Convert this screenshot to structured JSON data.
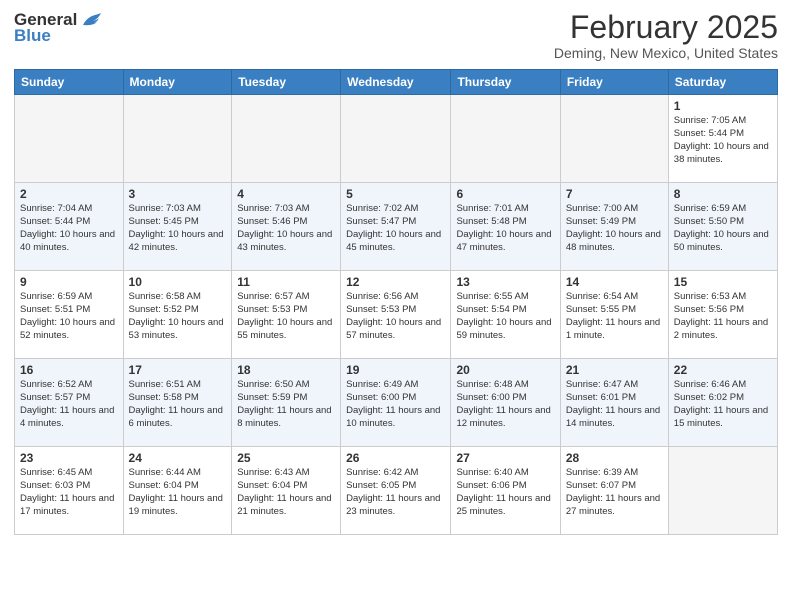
{
  "header": {
    "logo_general": "General",
    "logo_blue": "Blue",
    "month_title": "February 2025",
    "location": "Deming, New Mexico, United States"
  },
  "weekdays": [
    "Sunday",
    "Monday",
    "Tuesday",
    "Wednesday",
    "Thursday",
    "Friday",
    "Saturday"
  ],
  "weeks": [
    [
      {
        "day": "",
        "info": ""
      },
      {
        "day": "",
        "info": ""
      },
      {
        "day": "",
        "info": ""
      },
      {
        "day": "",
        "info": ""
      },
      {
        "day": "",
        "info": ""
      },
      {
        "day": "",
        "info": ""
      },
      {
        "day": "1",
        "info": "Sunrise: 7:05 AM\nSunset: 5:44 PM\nDaylight: 10 hours\nand 38 minutes."
      }
    ],
    [
      {
        "day": "2",
        "info": "Sunrise: 7:04 AM\nSunset: 5:44 PM\nDaylight: 10 hours\nand 40 minutes."
      },
      {
        "day": "3",
        "info": "Sunrise: 7:03 AM\nSunset: 5:45 PM\nDaylight: 10 hours\nand 42 minutes."
      },
      {
        "day": "4",
        "info": "Sunrise: 7:03 AM\nSunset: 5:46 PM\nDaylight: 10 hours\nand 43 minutes."
      },
      {
        "day": "5",
        "info": "Sunrise: 7:02 AM\nSunset: 5:47 PM\nDaylight: 10 hours\nand 45 minutes."
      },
      {
        "day": "6",
        "info": "Sunrise: 7:01 AM\nSunset: 5:48 PM\nDaylight: 10 hours\nand 47 minutes."
      },
      {
        "day": "7",
        "info": "Sunrise: 7:00 AM\nSunset: 5:49 PM\nDaylight: 10 hours\nand 48 minutes."
      },
      {
        "day": "8",
        "info": "Sunrise: 6:59 AM\nSunset: 5:50 PM\nDaylight: 10 hours\nand 50 minutes."
      }
    ],
    [
      {
        "day": "9",
        "info": "Sunrise: 6:59 AM\nSunset: 5:51 PM\nDaylight: 10 hours\nand 52 minutes."
      },
      {
        "day": "10",
        "info": "Sunrise: 6:58 AM\nSunset: 5:52 PM\nDaylight: 10 hours\nand 53 minutes."
      },
      {
        "day": "11",
        "info": "Sunrise: 6:57 AM\nSunset: 5:53 PM\nDaylight: 10 hours\nand 55 minutes."
      },
      {
        "day": "12",
        "info": "Sunrise: 6:56 AM\nSunset: 5:53 PM\nDaylight: 10 hours\nand 57 minutes."
      },
      {
        "day": "13",
        "info": "Sunrise: 6:55 AM\nSunset: 5:54 PM\nDaylight: 10 hours\nand 59 minutes."
      },
      {
        "day": "14",
        "info": "Sunrise: 6:54 AM\nSunset: 5:55 PM\nDaylight: 11 hours\nand 1 minute."
      },
      {
        "day": "15",
        "info": "Sunrise: 6:53 AM\nSunset: 5:56 PM\nDaylight: 11 hours\nand 2 minutes."
      }
    ],
    [
      {
        "day": "16",
        "info": "Sunrise: 6:52 AM\nSunset: 5:57 PM\nDaylight: 11 hours\nand 4 minutes."
      },
      {
        "day": "17",
        "info": "Sunrise: 6:51 AM\nSunset: 5:58 PM\nDaylight: 11 hours\nand 6 minutes."
      },
      {
        "day": "18",
        "info": "Sunrise: 6:50 AM\nSunset: 5:59 PM\nDaylight: 11 hours\nand 8 minutes."
      },
      {
        "day": "19",
        "info": "Sunrise: 6:49 AM\nSunset: 6:00 PM\nDaylight: 11 hours\nand 10 minutes."
      },
      {
        "day": "20",
        "info": "Sunrise: 6:48 AM\nSunset: 6:00 PM\nDaylight: 11 hours\nand 12 minutes."
      },
      {
        "day": "21",
        "info": "Sunrise: 6:47 AM\nSunset: 6:01 PM\nDaylight: 11 hours\nand 14 minutes."
      },
      {
        "day": "22",
        "info": "Sunrise: 6:46 AM\nSunset: 6:02 PM\nDaylight: 11 hours\nand 15 minutes."
      }
    ],
    [
      {
        "day": "23",
        "info": "Sunrise: 6:45 AM\nSunset: 6:03 PM\nDaylight: 11 hours\nand 17 minutes."
      },
      {
        "day": "24",
        "info": "Sunrise: 6:44 AM\nSunset: 6:04 PM\nDaylight: 11 hours\nand 19 minutes."
      },
      {
        "day": "25",
        "info": "Sunrise: 6:43 AM\nSunset: 6:04 PM\nDaylight: 11 hours\nand 21 minutes."
      },
      {
        "day": "26",
        "info": "Sunrise: 6:42 AM\nSunset: 6:05 PM\nDaylight: 11 hours\nand 23 minutes."
      },
      {
        "day": "27",
        "info": "Sunrise: 6:40 AM\nSunset: 6:06 PM\nDaylight: 11 hours\nand 25 minutes."
      },
      {
        "day": "28",
        "info": "Sunrise: 6:39 AM\nSunset: 6:07 PM\nDaylight: 11 hours\nand 27 minutes."
      },
      {
        "day": "",
        "info": ""
      }
    ]
  ]
}
